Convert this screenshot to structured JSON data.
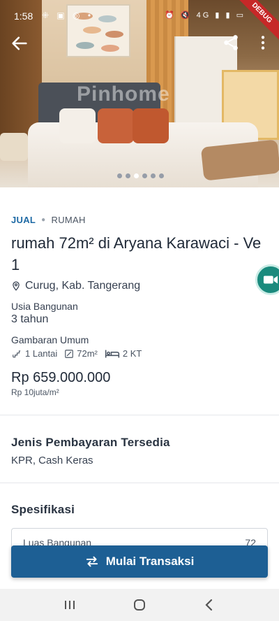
{
  "status_bar": {
    "time": "1:58",
    "left_icons": [
      "grid-icon",
      "image-icon",
      "whatsapp-icon",
      "dot"
    ],
    "right_icons": [
      "alarm-icon",
      "mute-icon",
      "4g-icon",
      "signal-icon",
      "signal-icon",
      "battery-icon"
    ],
    "network": "4G",
    "debug_banner": "DEBUG"
  },
  "hero": {
    "watermark": "Pinhome",
    "carousel": {
      "total": 6,
      "active_index": 2
    }
  },
  "top_actions": {
    "back": "back-arrow-icon",
    "share": "share-icon",
    "more": "more-vertical-icon"
  },
  "listing": {
    "type": "JUAL",
    "category": "RUMAH",
    "title": "rumah 72m² di Aryana Karawaci - Ve 1",
    "location": "Curug, Kab. Tangerang",
    "age_label": "Usia Bangunan",
    "age_value": "3 tahun",
    "overview_label": "Gambaran Umum",
    "features": {
      "floors": "1 Lantai",
      "area": "72m²",
      "bedrooms": "2 KT"
    },
    "price": "Rp 659.000.000",
    "price_per_m2": "Rp 10juta/m²"
  },
  "payment": {
    "title": "Jenis Pembayaran Tersedia",
    "methods": "KPR, Cash Keras"
  },
  "specs": {
    "title": "Spesifikasi",
    "first_row": {
      "label": "Luas Bangunan",
      "value": "72"
    }
  },
  "cta": {
    "label": "Mulai Transaksi",
    "icon": "swap-arrows-icon"
  },
  "colors": {
    "primary": "#1d5f94",
    "accent_teal": "#1a8a7d",
    "link_blue": "#1e6aa5"
  }
}
